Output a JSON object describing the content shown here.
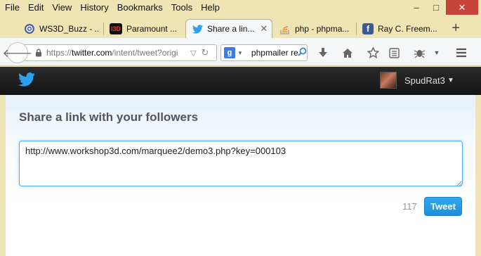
{
  "menubar": {
    "items": [
      "File",
      "Edit",
      "View",
      "History",
      "Bookmarks",
      "Tools",
      "Help"
    ],
    "window_controls": {
      "minimize": "–",
      "maximize": "□",
      "close": "✕"
    }
  },
  "tabs": [
    {
      "label": "WS3D_Buzz - ...",
      "icon": "ws3d-icon"
    },
    {
      "label": "Paramount ...",
      "icon": "paramount-icon"
    },
    {
      "label": "Share a lin...",
      "icon": "twitter-bird-icon",
      "active": true
    },
    {
      "label": "php - phpma...",
      "icon": "stackoverflow-icon"
    },
    {
      "label": "Ray C. Freem...",
      "icon": "facebook-icon"
    }
  ],
  "nav": {
    "url_prefix": "https://",
    "url_domain": "twitter.com",
    "url_path": "/intent/tweet?origi",
    "search_value": "phpmailer re"
  },
  "twitter": {
    "username": "SpudRat3"
  },
  "share": {
    "heading": "Share a link with your followers",
    "tweet_text": "http://www.workshop3d.com/marquee2/demo3.php?key=000103",
    "char_count": "117",
    "tweet_button": "Tweet"
  },
  "colors": {
    "accent": "#2ba2ed",
    "chrome": "#efe4b3",
    "header": "#1b1b1b"
  }
}
